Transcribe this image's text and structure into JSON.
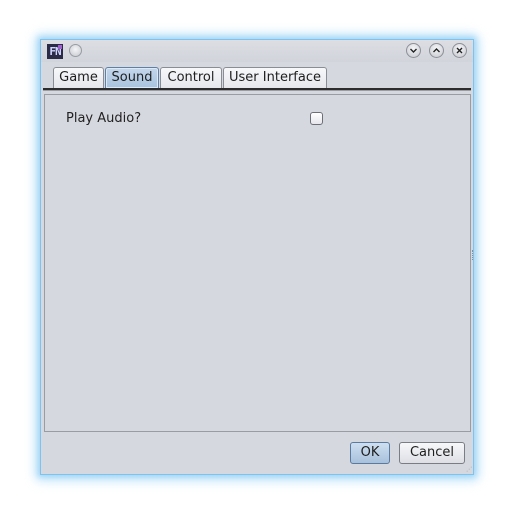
{
  "titlebar": {
    "app_icon_text": "FN",
    "icons": {
      "menu": "window-menu-icon",
      "minimize": "minimize-icon",
      "maximize": "maximize-icon",
      "close": "close-icon"
    }
  },
  "tabs": [
    {
      "label": "Game",
      "active": false
    },
    {
      "label": "Sound",
      "active": true
    },
    {
      "label": "Control",
      "active": false
    },
    {
      "label": "User Interface",
      "active": false
    }
  ],
  "sound": {
    "play_audio_label": "Play Audio?",
    "play_audio_checked": false
  },
  "buttons": {
    "ok_label": "OK",
    "cancel_label": "Cancel"
  },
  "colors": {
    "window_bg": "#d6d8df",
    "active_tab": "#a9c3de",
    "focus_glow": "#7dc3ee"
  }
}
